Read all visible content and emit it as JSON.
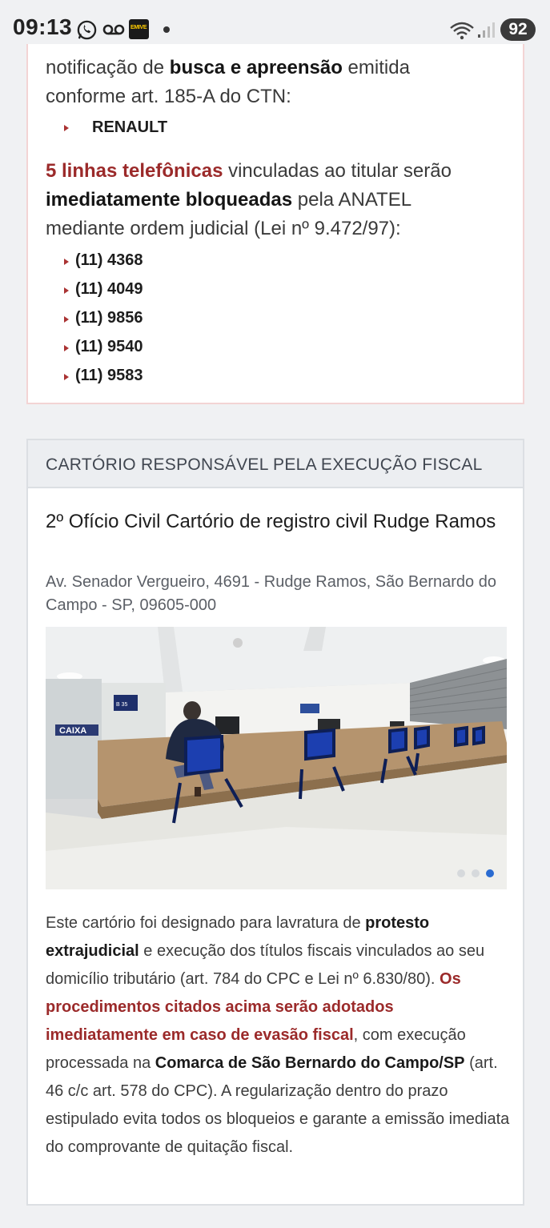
{
  "status_bar": {
    "time": "09:13",
    "app_icon_label": "EMIVE",
    "battery": "92"
  },
  "top_card": {
    "line1_pre": "notificação de ",
    "line1_bold": "busca e apreensão",
    "line1_post": " emitida",
    "line2": "conforme art. 185-A do CTN:",
    "vehicle": "RENAULT",
    "para2_red": "5 linhas telefônicas",
    "para2_post": " vinculadas ao titular serão",
    "para2_bold": "imediatamente bloqueadas",
    "para2_post2": " pela ANATEL",
    "para2_line3": "mediante ordem judicial (Lei nº 9.472/97):",
    "phones": [
      "(11) 4368",
      "(11) 4049",
      "(11) 9856",
      "(11) 9540",
      "(11) 9583"
    ]
  },
  "registry_card": {
    "header": "CARTÓRIO RESPONSÁVEL PELA EXECUÇÃO FISCAL",
    "title": "2º Ofício Civil Cartório de registro civil Rudge Ramos",
    "address": "Av. Senador Vergueiro, 4691 - Rudge Ramos, São Bernardo do Campo - SP, 09605-000",
    "photo_sign": "CAIXA",
    "photo_counter": "B 35",
    "carousel_active_index": 2,
    "carousel_count": 3,
    "body": {
      "t1": "Este cartório foi designado para lavratura de ",
      "b1": "protesto extrajudicial",
      "t2": " e execução dos títulos fiscais vinculados ao seu domicílio tributário (art. 784 do CPC e Lei nº 6.830/80). ",
      "r1": "Os procedimentos citados acima serão adotados imediatamente em caso de evasão fiscal",
      "t3": ", com execução processada na ",
      "b2": "Comarca de São Bernardo do Campo/SP",
      "t4": " (art. 46 c/c art. 578 do CPC). A regularização dentro do prazo estipulado evita todos os bloqueios e garante a emissão imediata do comprovante de quitação fiscal."
    }
  },
  "colors": {
    "accent_red": "#9b2a2a",
    "card_border_pink": "#f3d4d4",
    "carousel_active": "#2a6bd1"
  }
}
